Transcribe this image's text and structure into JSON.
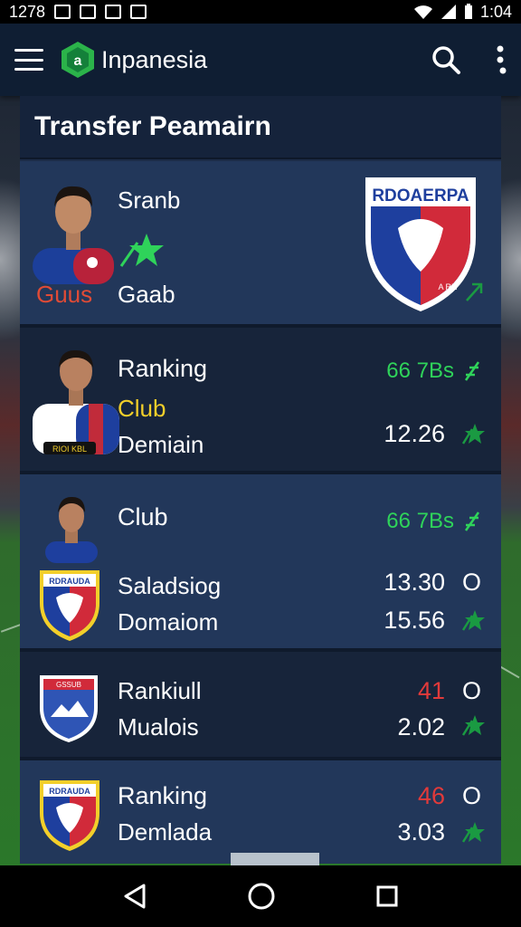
{
  "status_bar": {
    "left_text": "1278",
    "time": "1:04"
  },
  "app_bar": {
    "title": "Inpanesia",
    "icons": [
      "menu-icon",
      "app-logo-icon",
      "search-icon",
      "more-vert-icon"
    ]
  },
  "panel": {
    "title": "Transfer Peamairn"
  },
  "cards": [
    {
      "name": "Sranb",
      "sub_label": "Guus",
      "detail": "Gaab",
      "crest_text": "RDOAERPA",
      "crest_text_sub": "A RN"
    },
    {
      "title": "Ranking",
      "club": "Club",
      "detail": "Demiain",
      "top_value": "66 7Bs",
      "bottom_value": "12.26",
      "badge_text": "RIOI KBL"
    },
    {
      "title": "Club",
      "club": "Saladsiog",
      "detail": "Domaiom",
      "top_value": "66 7Bs",
      "value_1": "13.30",
      "value_1_suffix": "O",
      "value_2": "15.56",
      "crest_text": "RDRAUDA"
    },
    {
      "title": "Rankiull",
      "detail": "Mualois",
      "value_1": "41",
      "value_1_suffix": "O",
      "value_2": "2.02",
      "crest_text": "GSSUB"
    },
    {
      "title": "Ranking",
      "detail": "Demlada",
      "value_1": "46",
      "value_1_suffix": "O",
      "value_2": "3.03",
      "crest_text": "RDRAUDA"
    }
  ],
  "colors": {
    "app_bar": "#0f1e33",
    "panel": "#1c2c48",
    "card": "#22375a",
    "positive": "#2fd35a",
    "negative": "#e23a3a",
    "club_highlight": "#f3cf2a"
  },
  "nav_bar": {
    "icons": [
      "back-icon",
      "home-icon",
      "recents-icon"
    ]
  }
}
